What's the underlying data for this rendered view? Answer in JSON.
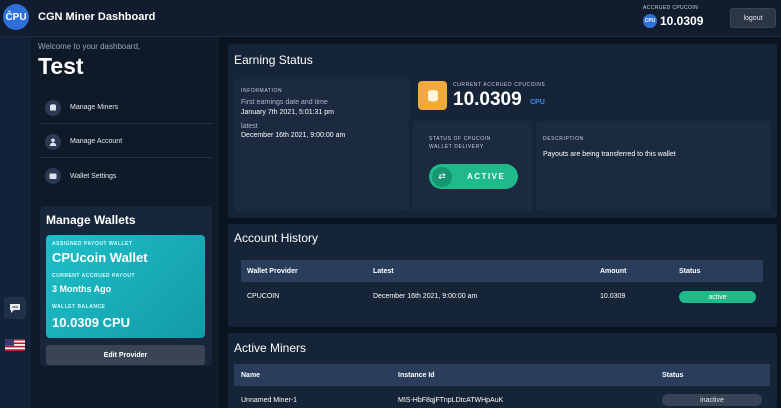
{
  "header": {
    "logo_text": "ĈPU",
    "app_title": "CGN Miner Dashboard",
    "accrued_label": "ACCRUED CPUCOIN",
    "coin_symbol": "CPU",
    "accrued_value": "10.0309",
    "logout_label": "logout"
  },
  "sidebar": {
    "welcome": "Welcome to your dashboard,",
    "username": "Test",
    "nav": [
      {
        "label": "Manage Miners",
        "icon": "database-icon"
      },
      {
        "label": "Manage Account",
        "icon": "user-icon"
      },
      {
        "label": "Wallet Settings",
        "icon": "wallet-icon"
      }
    ],
    "wallets": {
      "title": "Manage Wallets",
      "assigned_label": "ASSIGNED PAYOUT WALLET",
      "wallet_name": "CPUcoin Wallet",
      "payout_label": "CURRENT ACCRUED PAYOUT",
      "payout_value": "3 Months Ago",
      "balance_label": "WALLET BALANCE",
      "balance_value": "10.0309 CPU",
      "edit_button": "Edit Provider"
    }
  },
  "earning": {
    "title": "Earning Status",
    "info_label": "INFORMATION",
    "first_label": "First earnings date and time",
    "first_value": "January 7th 2021, 5:01:31 pm",
    "latest_label": "latest",
    "latest_value": "December 16th 2021, 9:00:00 am",
    "accrued_label": "CURRENT ACCRUED CPUCOINS",
    "accrued_value": "10.0309",
    "accrued_unit": "CPU",
    "delivery_label_1": "STATUS OF CPUCOIN",
    "delivery_label_2": "WALLET DELIVERY",
    "delivery_status": "ACTIVE",
    "description_label": "DESCRIPTION",
    "description_text": "Payouts are being transferred to this wallet"
  },
  "account_history": {
    "title": "Account History",
    "columns": [
      "Wallet Provider",
      "Latest",
      "Amount",
      "Status"
    ],
    "rows": [
      {
        "provider": "CPUCOIN",
        "latest": "December 16th 2021, 9:00:00 am",
        "amount": "10.0309",
        "status": "active"
      }
    ]
  },
  "active_miners": {
    "title": "Active Miners",
    "columns": [
      "Name",
      "Instance Id",
      "Status"
    ],
    "rows": [
      {
        "name": "Unnamed Miner-1",
        "instance": "MIS-HbF8qjFTnpLDtcATWHpAuK",
        "status": "inactive"
      }
    ]
  },
  "colors": {
    "accent_green": "#1fb98a",
    "accent_blue": "#3c8df0",
    "wallet_card": "#1ec0c9",
    "coin_gold": "#f2a93b"
  }
}
